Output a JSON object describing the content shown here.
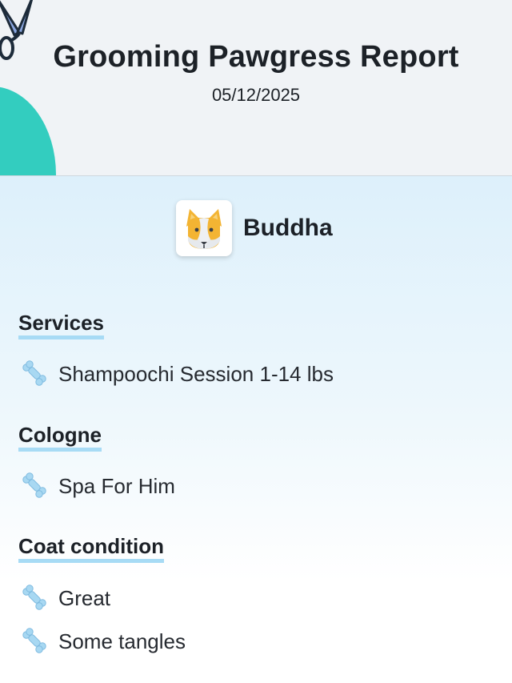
{
  "header": {
    "title": "Grooming Pawgress Report",
    "date": "05/12/2025"
  },
  "pet": {
    "name": "Buddha",
    "avatar_icon": "corgi-dog-face-icon"
  },
  "sections": {
    "services": {
      "heading": "Services",
      "items": [
        "Shampoochi Session 1-14 lbs"
      ]
    },
    "cologne": {
      "heading": "Cologne",
      "items": [
        "Spa For Him"
      ]
    },
    "coat_condition": {
      "heading": "Coat condition",
      "items": [
        "Great",
        "Some tangles"
      ]
    }
  },
  "icons": {
    "bullet": "bone-icon",
    "decoration": "scissors-icon"
  },
  "colors": {
    "accent_teal": "#33cdbf",
    "heading_underline": "#a7dbf5",
    "bone": "#a8d8f2"
  }
}
